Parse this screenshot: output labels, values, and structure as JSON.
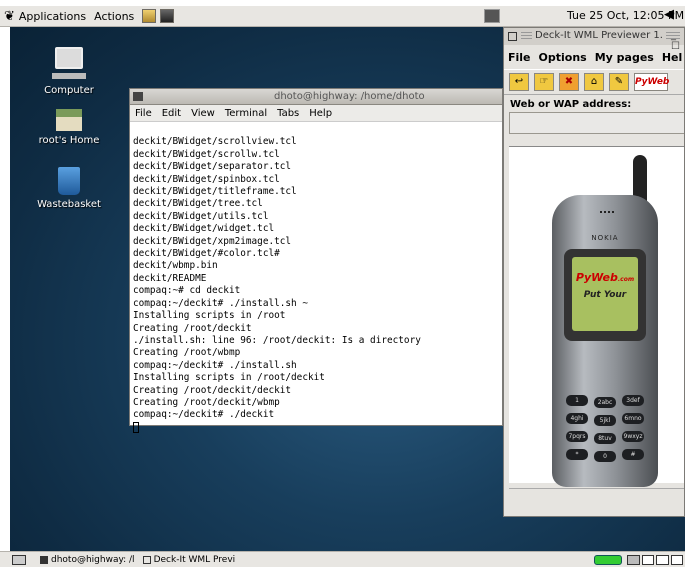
{
  "top_panel": {
    "applications_label": "Applications",
    "actions_label": "Actions",
    "clock": "Tue 25 Oct, 12:05 PM"
  },
  "desktop": {
    "icons": [
      {
        "label": "Computer",
        "icon": "computer-icon"
      },
      {
        "label": "root's Home",
        "icon": "home-folder-icon"
      },
      {
        "label": "Wastebasket",
        "icon": "trash-icon"
      }
    ]
  },
  "terminal": {
    "title": "dhoto@highway: /home/dhoto",
    "menu": [
      "File",
      "Edit",
      "View",
      "Terminal",
      "Tabs",
      "Help"
    ],
    "lines": [
      "deckit/BWidget/scrollview.tcl",
      "deckit/BWidget/scrollw.tcl",
      "deckit/BWidget/separator.tcl",
      "deckit/BWidget/spinbox.tcl",
      "deckit/BWidget/titleframe.tcl",
      "deckit/BWidget/tree.tcl",
      "deckit/BWidget/utils.tcl",
      "deckit/BWidget/widget.tcl",
      "deckit/BWidget/xpm2image.tcl",
      "deckit/BWidget/#color.tcl#",
      "deckit/wbmp.bin",
      "deckit/README",
      "compaq:~# cd deckit",
      "compaq:~/deckit# ./install.sh ~",
      "Installing scripts in /root",
      "Creating /root/deckit",
      "./install.sh: line 96: /root/deckit: Is a directory",
      "Creating /root/wbmp",
      "compaq:~/deckit# ./install.sh",
      "Installing scripts in /root/deckit",
      "Creating /root/deckit/deckit",
      "Creating /root/deckit/wbmp",
      "compaq:~/deckit# ./deckit"
    ]
  },
  "deckit": {
    "title": "Deck-It WML Previewer 1.",
    "menu": {
      "file": "File",
      "options": "Options",
      "mypages": "My pages",
      "help": "Hel"
    },
    "toolbar_logo": "PyWeb",
    "address_label": "Web or WAP address:",
    "address_value": "",
    "phone": {
      "brand": "NOKIA",
      "logo": "PyWeb",
      "logo_sub": ".com",
      "screen_text": "Put Your",
      "keys": [
        "1",
        "2abc",
        "3def",
        "4ghi",
        "5jkl",
        "6mno",
        "7pqrs",
        "8tuv",
        "9wxyz",
        "*",
        "0",
        "#"
      ]
    }
  },
  "bottom_panel": {
    "tasks": [
      "dhoto@highway: /l",
      "Deck-It WML Previ"
    ]
  }
}
